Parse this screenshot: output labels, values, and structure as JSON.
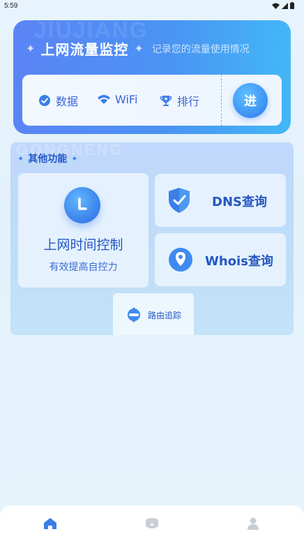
{
  "status_bar": {
    "time": "5:59"
  },
  "top_card": {
    "watermark": "JIUJIANG",
    "title": "上网流量监控",
    "subtitle": "记录您的流量使用情况",
    "items": [
      {
        "label": "数据",
        "icon": "check-circle-icon"
      },
      {
        "label": "WiFi",
        "icon": "wifi-icon"
      },
      {
        "label": "排行",
        "icon": "trophy-icon"
      }
    ],
    "go_label": "进"
  },
  "features": {
    "watermark": "GONGNENG",
    "title": "其他功能",
    "time_control": {
      "title": "上网时间控制",
      "subtitle": "有效提高自控力",
      "icon": "clock-icon"
    },
    "dns": {
      "label": "DNS查询",
      "icon": "shield-check-icon"
    },
    "whois": {
      "label": "Whois查询",
      "icon": "location-pin-icon"
    },
    "route": {
      "label": "路由追踪",
      "icon": "route-icon"
    }
  },
  "bottom_nav": {
    "items": [
      {
        "icon": "home-icon",
        "active": true
      },
      {
        "icon": "box-icon",
        "active": false
      },
      {
        "icon": "person-icon",
        "active": false
      }
    ],
    "colors": {
      "active": "#3a7fe8",
      "inactive": "#c9ced6"
    }
  }
}
